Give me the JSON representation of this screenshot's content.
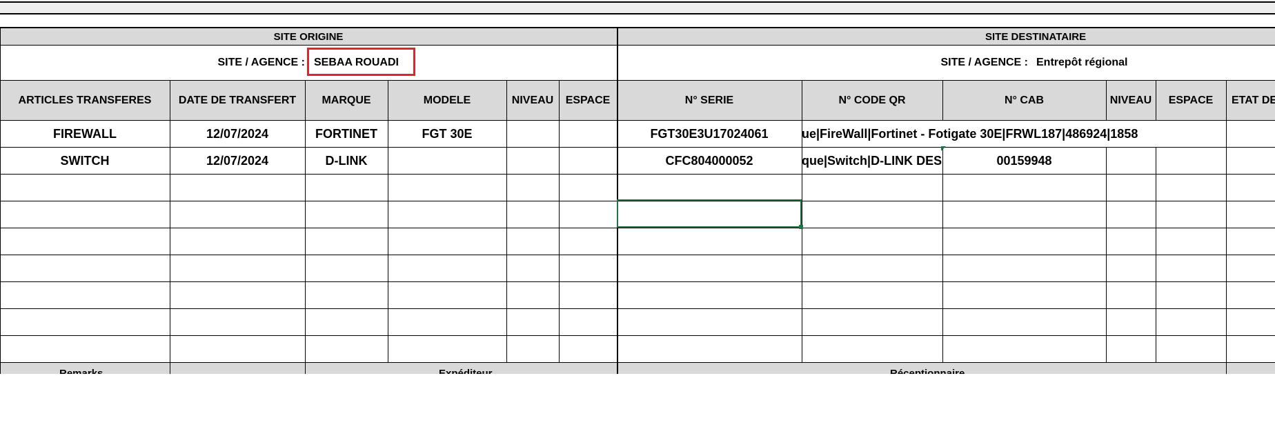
{
  "site_origine": {
    "title": "SITE ORIGINE",
    "agence_label": "SITE / AGENCE :",
    "agence_value": "SEBAA ROUADI"
  },
  "site_destinataire": {
    "title": "SITE DESTINATAIRE",
    "agence_label": "SITE / AGENCE :",
    "agence_value": "Entrepôt régional"
  },
  "columns": [
    "ARTICLES TRANSFERES",
    "DATE DE TRANSFERT",
    "MARQUE",
    "MODELE",
    "NIVEAU",
    "ESPACE",
    "N° SERIE",
    "N° CODE QR",
    "N° CAB",
    "NIVEAU",
    "ESPACE",
    "ETAT DE"
  ],
  "rows": [
    {
      "article": "FIREWALL",
      "date": "12/07/2024",
      "marque": "FORTINET",
      "modele": "FGT 30E",
      "niveau": "",
      "espace": "",
      "serie": "FGT30E3U17024061",
      "code_qr": "ue|FireWall|Fortinet - Fotigate 30E|FRWL187|486924|1858",
      "cab": "",
      "niveau2": "",
      "espace2": "",
      "etat": ""
    },
    {
      "article": "SWITCH",
      "date": "12/07/2024",
      "marque": "D-LINK",
      "modele": "",
      "niveau": "",
      "espace": "",
      "serie": "CFC804000052",
      "code_qr": "que|Switch|D-LINK DES",
      "cab": "00159948",
      "niveau2": "",
      "espace2": "",
      "etat": ""
    }
  ],
  "footer": {
    "left": "Remarks",
    "middle": "Expéditeur",
    "right": "Réceptionnaire"
  }
}
